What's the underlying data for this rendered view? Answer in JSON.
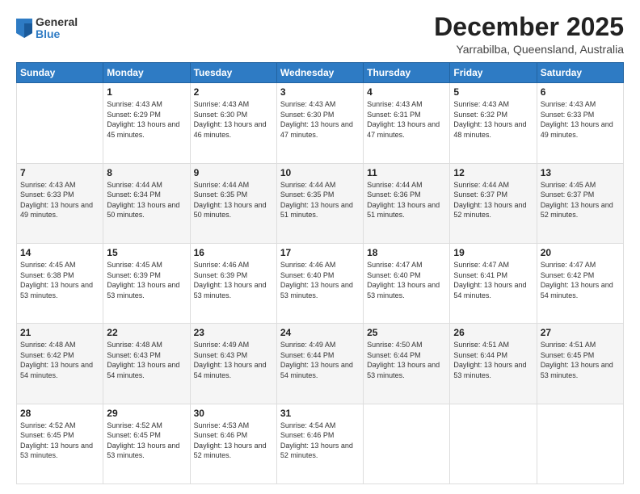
{
  "header": {
    "logo_general": "General",
    "logo_blue": "Blue",
    "month_title": "December 2025",
    "location": "Yarrabilba, Queensland, Australia"
  },
  "weekdays": [
    "Sunday",
    "Monday",
    "Tuesday",
    "Wednesday",
    "Thursday",
    "Friday",
    "Saturday"
  ],
  "weeks": [
    [
      {
        "day": "",
        "sunrise": "",
        "sunset": "",
        "daylight": ""
      },
      {
        "day": "1",
        "sunrise": "Sunrise: 4:43 AM",
        "sunset": "Sunset: 6:29 PM",
        "daylight": "Daylight: 13 hours and 45 minutes."
      },
      {
        "day": "2",
        "sunrise": "Sunrise: 4:43 AM",
        "sunset": "Sunset: 6:30 PM",
        "daylight": "Daylight: 13 hours and 46 minutes."
      },
      {
        "day": "3",
        "sunrise": "Sunrise: 4:43 AM",
        "sunset": "Sunset: 6:30 PM",
        "daylight": "Daylight: 13 hours and 47 minutes."
      },
      {
        "day": "4",
        "sunrise": "Sunrise: 4:43 AM",
        "sunset": "Sunset: 6:31 PM",
        "daylight": "Daylight: 13 hours and 47 minutes."
      },
      {
        "day": "5",
        "sunrise": "Sunrise: 4:43 AM",
        "sunset": "Sunset: 6:32 PM",
        "daylight": "Daylight: 13 hours and 48 minutes."
      },
      {
        "day": "6",
        "sunrise": "Sunrise: 4:43 AM",
        "sunset": "Sunset: 6:33 PM",
        "daylight": "Daylight: 13 hours and 49 minutes."
      }
    ],
    [
      {
        "day": "7",
        "sunrise": "Sunrise: 4:43 AM",
        "sunset": "Sunset: 6:33 PM",
        "daylight": "Daylight: 13 hours and 49 minutes."
      },
      {
        "day": "8",
        "sunrise": "Sunrise: 4:44 AM",
        "sunset": "Sunset: 6:34 PM",
        "daylight": "Daylight: 13 hours and 50 minutes."
      },
      {
        "day": "9",
        "sunrise": "Sunrise: 4:44 AM",
        "sunset": "Sunset: 6:35 PM",
        "daylight": "Daylight: 13 hours and 50 minutes."
      },
      {
        "day": "10",
        "sunrise": "Sunrise: 4:44 AM",
        "sunset": "Sunset: 6:35 PM",
        "daylight": "Daylight: 13 hours and 51 minutes."
      },
      {
        "day": "11",
        "sunrise": "Sunrise: 4:44 AM",
        "sunset": "Sunset: 6:36 PM",
        "daylight": "Daylight: 13 hours and 51 minutes."
      },
      {
        "day": "12",
        "sunrise": "Sunrise: 4:44 AM",
        "sunset": "Sunset: 6:37 PM",
        "daylight": "Daylight: 13 hours and 52 minutes."
      },
      {
        "day": "13",
        "sunrise": "Sunrise: 4:45 AM",
        "sunset": "Sunset: 6:37 PM",
        "daylight": "Daylight: 13 hours and 52 minutes."
      }
    ],
    [
      {
        "day": "14",
        "sunrise": "Sunrise: 4:45 AM",
        "sunset": "Sunset: 6:38 PM",
        "daylight": "Daylight: 13 hours and 53 minutes."
      },
      {
        "day": "15",
        "sunrise": "Sunrise: 4:45 AM",
        "sunset": "Sunset: 6:39 PM",
        "daylight": "Daylight: 13 hours and 53 minutes."
      },
      {
        "day": "16",
        "sunrise": "Sunrise: 4:46 AM",
        "sunset": "Sunset: 6:39 PM",
        "daylight": "Daylight: 13 hours and 53 minutes."
      },
      {
        "day": "17",
        "sunrise": "Sunrise: 4:46 AM",
        "sunset": "Sunset: 6:40 PM",
        "daylight": "Daylight: 13 hours and 53 minutes."
      },
      {
        "day": "18",
        "sunrise": "Sunrise: 4:47 AM",
        "sunset": "Sunset: 6:40 PM",
        "daylight": "Daylight: 13 hours and 53 minutes."
      },
      {
        "day": "19",
        "sunrise": "Sunrise: 4:47 AM",
        "sunset": "Sunset: 6:41 PM",
        "daylight": "Daylight: 13 hours and 54 minutes."
      },
      {
        "day": "20",
        "sunrise": "Sunrise: 4:47 AM",
        "sunset": "Sunset: 6:42 PM",
        "daylight": "Daylight: 13 hours and 54 minutes."
      }
    ],
    [
      {
        "day": "21",
        "sunrise": "Sunrise: 4:48 AM",
        "sunset": "Sunset: 6:42 PM",
        "daylight": "Daylight: 13 hours and 54 minutes."
      },
      {
        "day": "22",
        "sunrise": "Sunrise: 4:48 AM",
        "sunset": "Sunset: 6:43 PM",
        "daylight": "Daylight: 13 hours and 54 minutes."
      },
      {
        "day": "23",
        "sunrise": "Sunrise: 4:49 AM",
        "sunset": "Sunset: 6:43 PM",
        "daylight": "Daylight: 13 hours and 54 minutes."
      },
      {
        "day": "24",
        "sunrise": "Sunrise: 4:49 AM",
        "sunset": "Sunset: 6:44 PM",
        "daylight": "Daylight: 13 hours and 54 minutes."
      },
      {
        "day": "25",
        "sunrise": "Sunrise: 4:50 AM",
        "sunset": "Sunset: 6:44 PM",
        "daylight": "Daylight: 13 hours and 53 minutes."
      },
      {
        "day": "26",
        "sunrise": "Sunrise: 4:51 AM",
        "sunset": "Sunset: 6:44 PM",
        "daylight": "Daylight: 13 hours and 53 minutes."
      },
      {
        "day": "27",
        "sunrise": "Sunrise: 4:51 AM",
        "sunset": "Sunset: 6:45 PM",
        "daylight": "Daylight: 13 hours and 53 minutes."
      }
    ],
    [
      {
        "day": "28",
        "sunrise": "Sunrise: 4:52 AM",
        "sunset": "Sunset: 6:45 PM",
        "daylight": "Daylight: 13 hours and 53 minutes."
      },
      {
        "day": "29",
        "sunrise": "Sunrise: 4:52 AM",
        "sunset": "Sunset: 6:45 PM",
        "daylight": "Daylight: 13 hours and 53 minutes."
      },
      {
        "day": "30",
        "sunrise": "Sunrise: 4:53 AM",
        "sunset": "Sunset: 6:46 PM",
        "daylight": "Daylight: 13 hours and 52 minutes."
      },
      {
        "day": "31",
        "sunrise": "Sunrise: 4:54 AM",
        "sunset": "Sunset: 6:46 PM",
        "daylight": "Daylight: 13 hours and 52 minutes."
      },
      {
        "day": "",
        "sunrise": "",
        "sunset": "",
        "daylight": ""
      },
      {
        "day": "",
        "sunrise": "",
        "sunset": "",
        "daylight": ""
      },
      {
        "day": "",
        "sunrise": "",
        "sunset": "",
        "daylight": ""
      }
    ]
  ]
}
